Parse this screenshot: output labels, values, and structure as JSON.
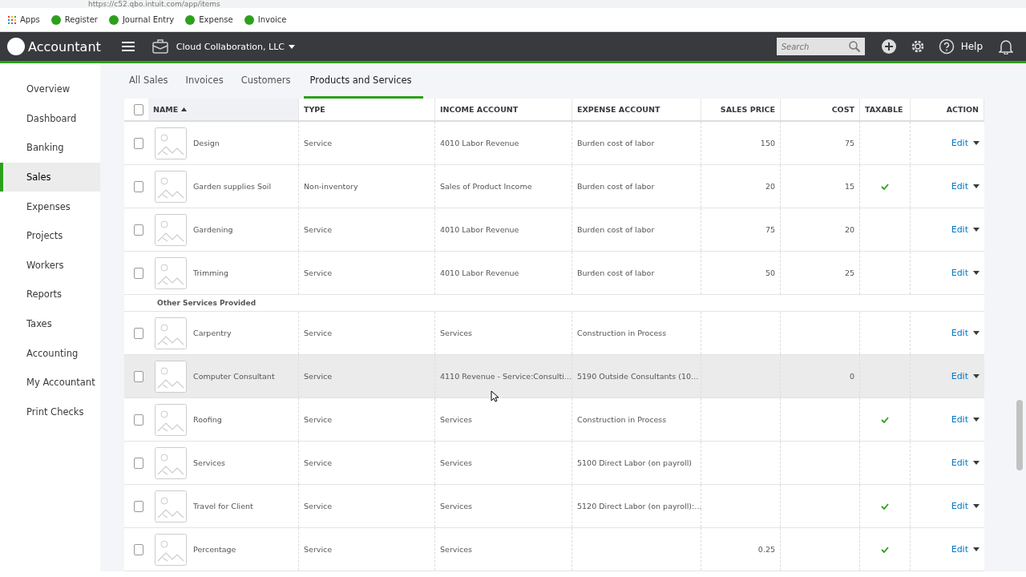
{
  "browser": {
    "url": "https://c52.qbo.intuit.com/app/items",
    "bookmarks": [
      {
        "kind": "apps",
        "label": "Apps"
      },
      {
        "kind": "qb",
        "label": "Register"
      },
      {
        "kind": "qb",
        "label": "Journal Entry"
      },
      {
        "kind": "qb",
        "label": "Expense"
      },
      {
        "kind": "qb",
        "label": "Invoice"
      }
    ]
  },
  "topbar": {
    "product": "Accountant",
    "company": "Cloud Collaboration, LLC",
    "search": {
      "placeholder": "Search"
    },
    "help": "Help"
  },
  "sidebar": {
    "items": [
      {
        "label": "Overview",
        "selected": false
      },
      {
        "label": "Dashboard",
        "selected": false
      },
      {
        "label": "Banking",
        "selected": false
      },
      {
        "label": "Sales",
        "selected": true
      },
      {
        "label": "Expenses",
        "selected": false
      },
      {
        "label": "Projects",
        "selected": false
      },
      {
        "label": "Workers",
        "selected": false
      },
      {
        "label": "Reports",
        "selected": false
      },
      {
        "label": "Taxes",
        "selected": false
      },
      {
        "label": "Accounting",
        "selected": false
      },
      {
        "label": "My Accountant",
        "selected": false
      },
      {
        "label": "Print Checks",
        "selected": false
      }
    ]
  },
  "tabs": [
    {
      "label": "All Sales",
      "selected": false
    },
    {
      "label": "Invoices",
      "selected": false
    },
    {
      "label": "Customers",
      "selected": false
    },
    {
      "label": "Products and Services",
      "selected": true
    }
  ],
  "table": {
    "select_all": {
      "checked": false
    },
    "columns": [
      {
        "label": "NAME",
        "sorted": true
      },
      {
        "label": "TYPE",
        "sorted": false
      },
      {
        "label": "INCOME ACCOUNT",
        "sorted": false
      },
      {
        "label": "EXPENSE ACCOUNT",
        "sorted": false
      },
      {
        "label": "SALES PRICE",
        "sorted": false
      },
      {
        "label": "COST",
        "sorted": false
      },
      {
        "label": "TAXABLE",
        "sorted": false
      },
      {
        "label": "ACTION",
        "sorted": false
      }
    ],
    "rows": [
      {
        "kind": "item",
        "checked": false,
        "hovered": false,
        "name": "Design",
        "type": "Service",
        "income_account": "4010 Labor Revenue",
        "expense_account": "Burden cost of labor",
        "sales_price": "150",
        "cost": "75",
        "taxable": false,
        "action": "Edit"
      },
      {
        "kind": "item",
        "checked": false,
        "hovered": false,
        "name": "Garden supplies Soil",
        "type": "Non-inventory",
        "income_account": "Sales of Product Income",
        "expense_account": "Burden cost of labor",
        "sales_price": "20",
        "cost": "15",
        "taxable": true,
        "action": "Edit"
      },
      {
        "kind": "item",
        "checked": false,
        "hovered": false,
        "name": "Gardening",
        "type": "Service",
        "income_account": "4010 Labor Revenue",
        "expense_account": "Burden cost of labor",
        "sales_price": "75",
        "cost": "20",
        "taxable": false,
        "action": "Edit"
      },
      {
        "kind": "item",
        "checked": false,
        "hovered": false,
        "name": "Trimming",
        "type": "Service",
        "income_account": "4010 Labor Revenue",
        "expense_account": "Burden cost of labor",
        "sales_price": "50",
        "cost": "25",
        "taxable": false,
        "action": "Edit"
      },
      {
        "kind": "group",
        "name": "Other Services Provided"
      },
      {
        "kind": "item",
        "checked": false,
        "hovered": false,
        "name": "Carpentry",
        "type": "Service",
        "income_account": "Services",
        "expense_account": "Construction in Process",
        "taxable": false,
        "action": "Edit"
      },
      {
        "kind": "item",
        "checked": false,
        "hovered": true,
        "name": "Computer Consultant",
        "type": "Service",
        "income_account": "4110 Revenue - Service:Consulti…",
        "expense_account": "5190 Outside Consultants (10…",
        "cost": "0",
        "taxable": false,
        "action": "Edit"
      },
      {
        "kind": "item",
        "checked": false,
        "hovered": false,
        "name": "Roofing",
        "type": "Service",
        "income_account": "Services",
        "expense_account": "Construction in Process",
        "taxable": true,
        "action": "Edit"
      },
      {
        "kind": "item",
        "checked": false,
        "hovered": false,
        "name": "Services",
        "type": "Service",
        "income_account": "Services",
        "expense_account": "5100 Direct Labor (on payroll)",
        "taxable": false,
        "action": "Edit"
      },
      {
        "kind": "item",
        "checked": false,
        "hovered": false,
        "name": "Travel for Client",
        "type": "Service",
        "income_account": "Services",
        "expense_account": "5120 Direct Labor (on payroll):…",
        "taxable": true,
        "action": "Edit"
      },
      {
        "kind": "item",
        "checked": false,
        "hovered": false,
        "name": "Percentage",
        "type": "Service",
        "income_account": "Services",
        "sales_price": "0.25",
        "taxable": true,
        "action": "Edit"
      }
    ]
  }
}
